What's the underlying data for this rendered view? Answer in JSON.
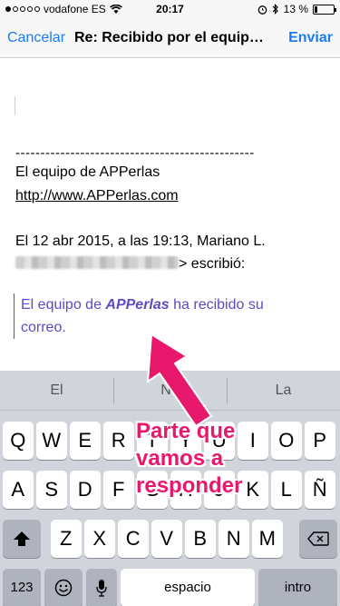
{
  "status_bar": {
    "carrier": "vodafone ES",
    "time": "20:17",
    "battery_percent": "13 %",
    "battery_level": 0.13
  },
  "nav": {
    "cancel_label": "Cancelar",
    "title": "Re: Recibido por el equipo de APPerlas",
    "send_label": "Enviar"
  },
  "body": {
    "separator": "------------------------------------------------",
    "signature_name": "El equipo de APPerlas",
    "signature_url": "http://www.APPerlas.com",
    "reply_header": "El 12 abr 2015, a las 19:13, Mariano L.",
    "reply_wrote": "> escribió:",
    "quote_prefix": "El equipo de ",
    "quote_brand": "APPerlas",
    "quote_suffix": " ha recibido su correo."
  },
  "annotation": {
    "line1": "Parte que",
    "line2": "vamos a",
    "line3": "responder",
    "color": "#e8196d"
  },
  "keyboard": {
    "suggestions": [
      "El",
      "No",
      "La"
    ],
    "row1": [
      "Q",
      "W",
      "E",
      "R",
      "T",
      "Y",
      "U",
      "I",
      "O",
      "P"
    ],
    "row2": [
      "A",
      "S",
      "D",
      "F",
      "G",
      "H",
      "J",
      "K",
      "L",
      "Ñ"
    ],
    "row3": [
      "Z",
      "X",
      "C",
      "V",
      "B",
      "N",
      "M"
    ],
    "numbers_label": "123",
    "space_label": "espacio",
    "return_label": "intro"
  },
  "colors": {
    "accent": "#1a7cf4",
    "quote": "#5c4bc2"
  }
}
